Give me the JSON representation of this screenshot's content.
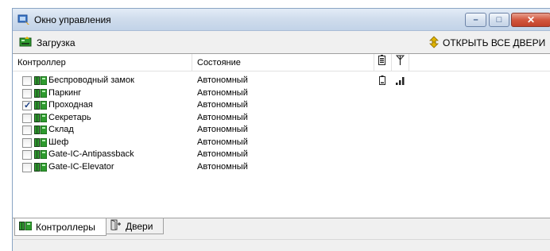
{
  "window": {
    "title": "Окно управления",
    "buttons": {
      "minimize": "–",
      "maximize": "□",
      "close": "✕"
    }
  },
  "toolbar": {
    "load_label": "Загрузка",
    "open_all_label": "ОТКРЫТЬ ВСЕ ДВЕРИ"
  },
  "table": {
    "columns": {
      "controller": "Контроллер",
      "state": "Состояние",
      "battery_icon": "battery-icon",
      "signal_icon": "antenna-icon"
    },
    "rows": [
      {
        "name": "Беспроводный замок",
        "state": "Автономный",
        "checked": false,
        "battery": "▯",
        "signal": "▂▄▆"
      },
      {
        "name": "Паркинг",
        "state": "Автономный",
        "checked": false
      },
      {
        "name": "Проходная",
        "state": "Автономный",
        "checked": true
      },
      {
        "name": "Секретарь",
        "state": "Автономный",
        "checked": false
      },
      {
        "name": "Склад",
        "state": "Автономный",
        "checked": false
      },
      {
        "name": "Шеф",
        "state": "Автономный",
        "checked": false
      },
      {
        "name": "Gate-IC-Antipassback",
        "state": "Автономный",
        "checked": false
      },
      {
        "name": "Gate-IC-Elevator",
        "state": "Автономный",
        "checked": false
      }
    ]
  },
  "tabs": [
    {
      "label": "Контроллеры",
      "active": true
    },
    {
      "label": "Двери",
      "active": false
    }
  ],
  "colors": {
    "controller_icon_green": "#2e9b2e",
    "controller_icon_dark": "#1a3f1a",
    "open_doors_icon": "#e0b400",
    "checkmark": "#1a3e84"
  }
}
